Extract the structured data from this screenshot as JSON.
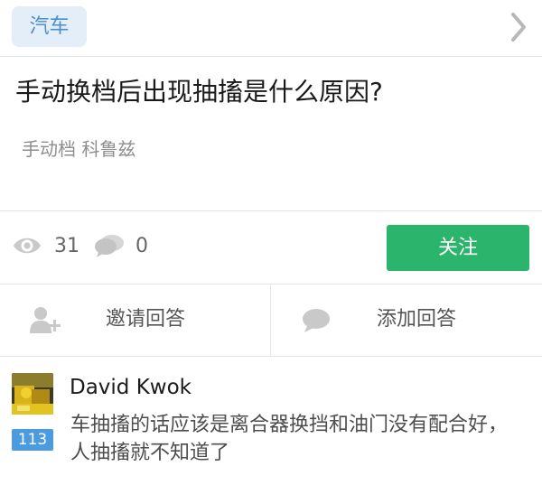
{
  "category": {
    "label": "汽车"
  },
  "question": {
    "title": "手动换档后出现抽搐是什么原因?",
    "topics": "手动档 科鲁兹"
  },
  "stats": {
    "views": "31",
    "comments": "0",
    "follow_label": "关注"
  },
  "actions": {
    "invite_label": "邀请回答",
    "add_answer_label": "添加回答"
  },
  "answer": {
    "username": "David Kwok",
    "votes": "113",
    "excerpt": "车抽搐的话应该是离合器换挡和油门没有配合好，人抽搐就不知道了"
  },
  "colors": {
    "accent_green": "#2bb56c",
    "tag_bg": "#e4eef8",
    "tag_text": "#4a8fcf",
    "badge_blue": "#4a9be0"
  },
  "icons": [
    "chevron-right-icon",
    "eye-icon",
    "comment-icon",
    "add-user-icon",
    "chat-bubble-icon"
  ]
}
